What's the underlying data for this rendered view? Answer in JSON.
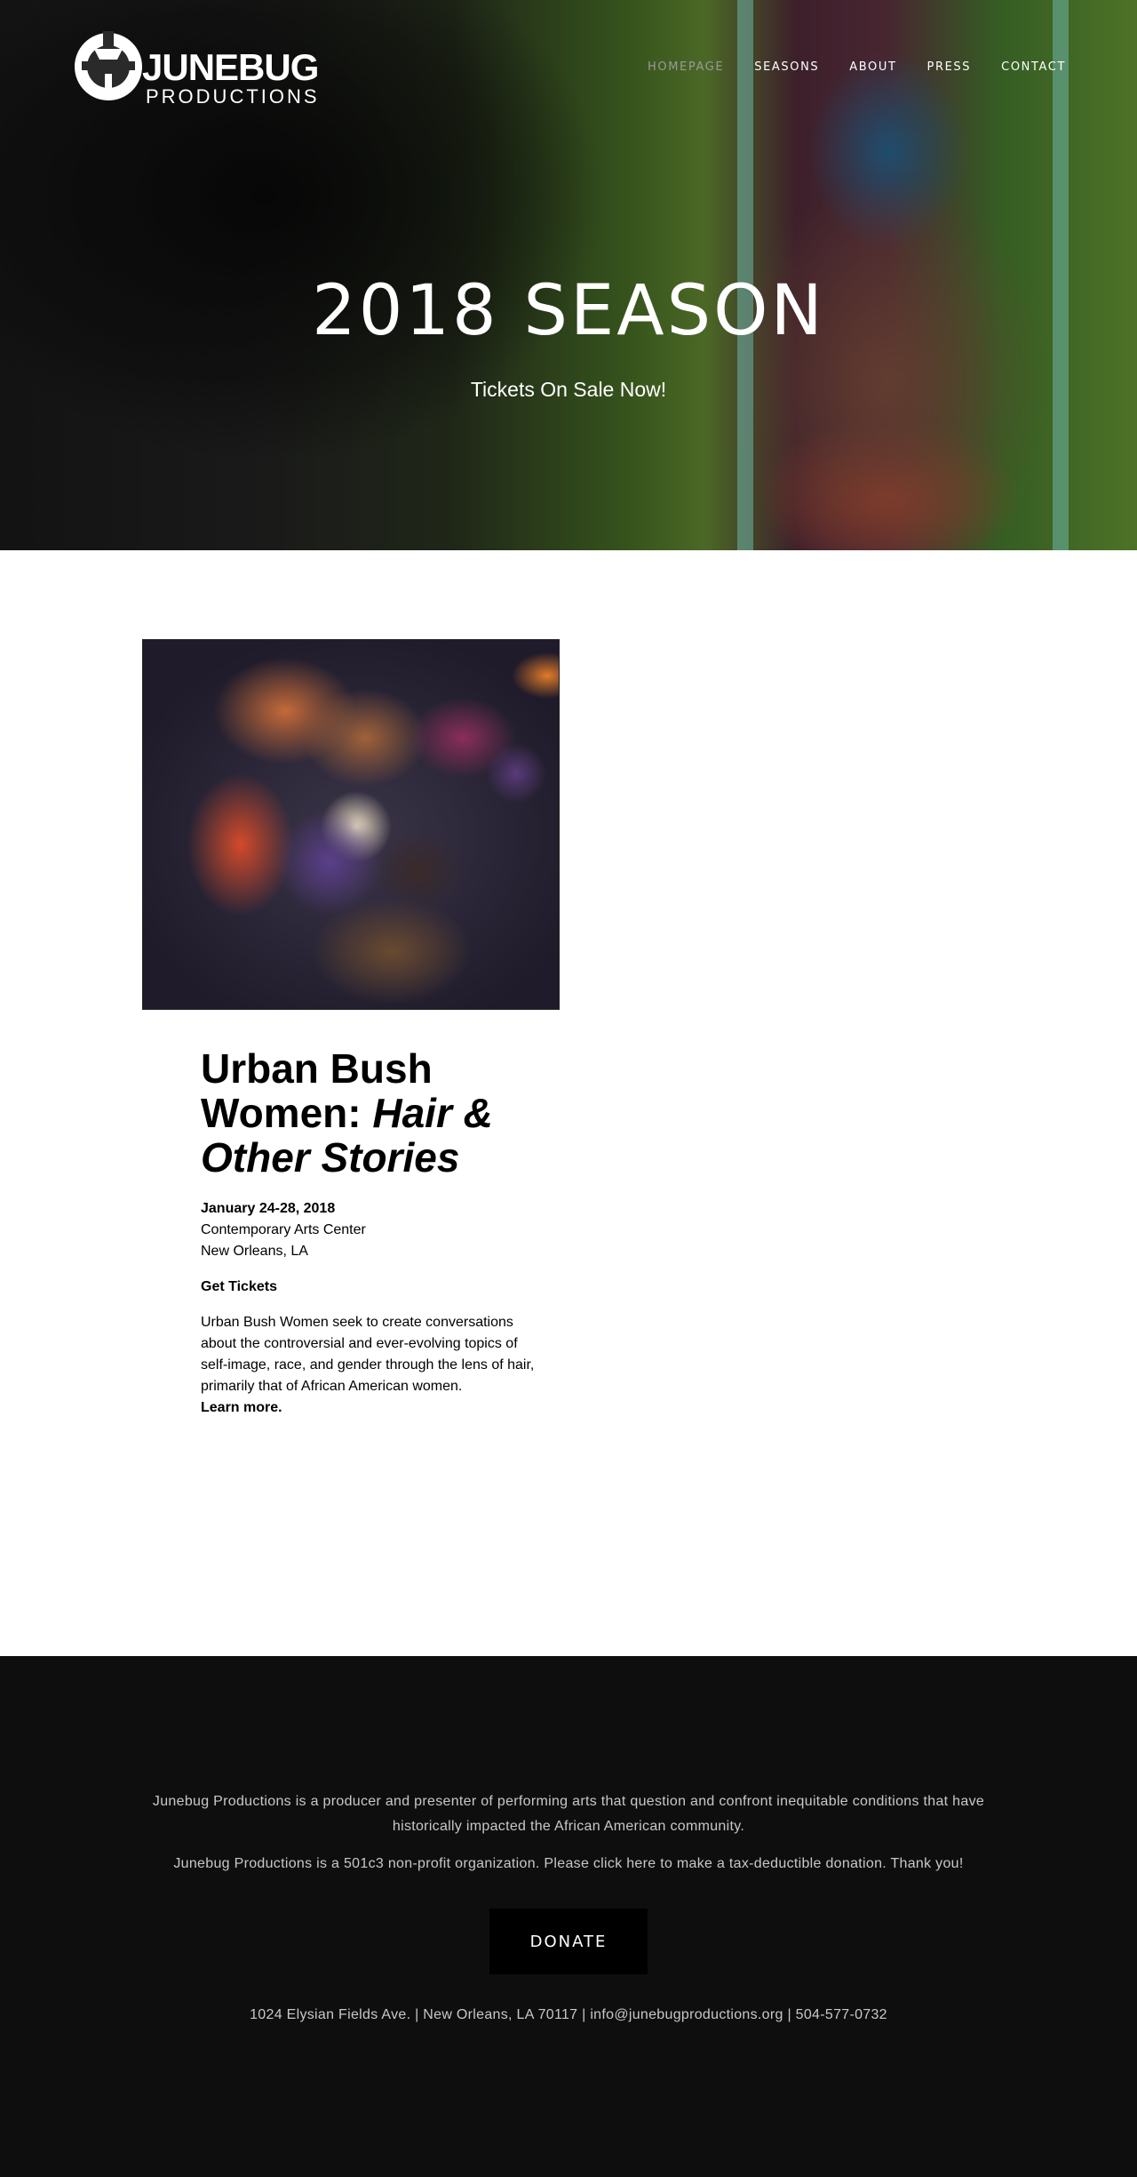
{
  "header": {
    "logo_text": "JUNEBUG",
    "logo_sub": "PRODUCTIONS",
    "nav": [
      {
        "label": "HOMEPAGE",
        "active": true
      },
      {
        "label": "SEASONS",
        "active": false
      },
      {
        "label": "ABOUT",
        "active": false
      },
      {
        "label": "PRESS",
        "active": false
      },
      {
        "label": "CONTACT",
        "active": false
      }
    ]
  },
  "hero": {
    "title": "2018 SEASON",
    "subtitle": "Tickets On Sale Now!"
  },
  "event": {
    "title_plain": "Urban Bush Women: ",
    "title_italic": "Hair & Other Stories",
    "date": "January 24-28, 2018",
    "venue": "Contemporary Arts Center",
    "city": "New Orleans, LA",
    "tickets_label": "Get Tickets",
    "description": "Urban Bush Women seek to create conversations about the controversial and ever-evolving topics of self-image, race, and gender through the lens of hair, primarily that of African American women.",
    "learn_more": "Learn more."
  },
  "footer": {
    "about": "Junebug Productions is a producer and presenter of performing arts that question and confront inequitable conditions that have historically impacted the African American community.",
    "nonprofit": "Junebug Productions is a 501c3 non-profit organization. Please click here to make a tax-deductible donation. Thank you!",
    "donate_label": "DONATE",
    "contact": "1024 Elysian Fields Ave. | New Orleans, LA 70117  | info@junebugproductions.org | 504-577-0732"
  },
  "colors": {
    "footer_bg": "#0e0e0e",
    "donate_bg": "#000000",
    "nav_active": "#9a9a9a"
  }
}
